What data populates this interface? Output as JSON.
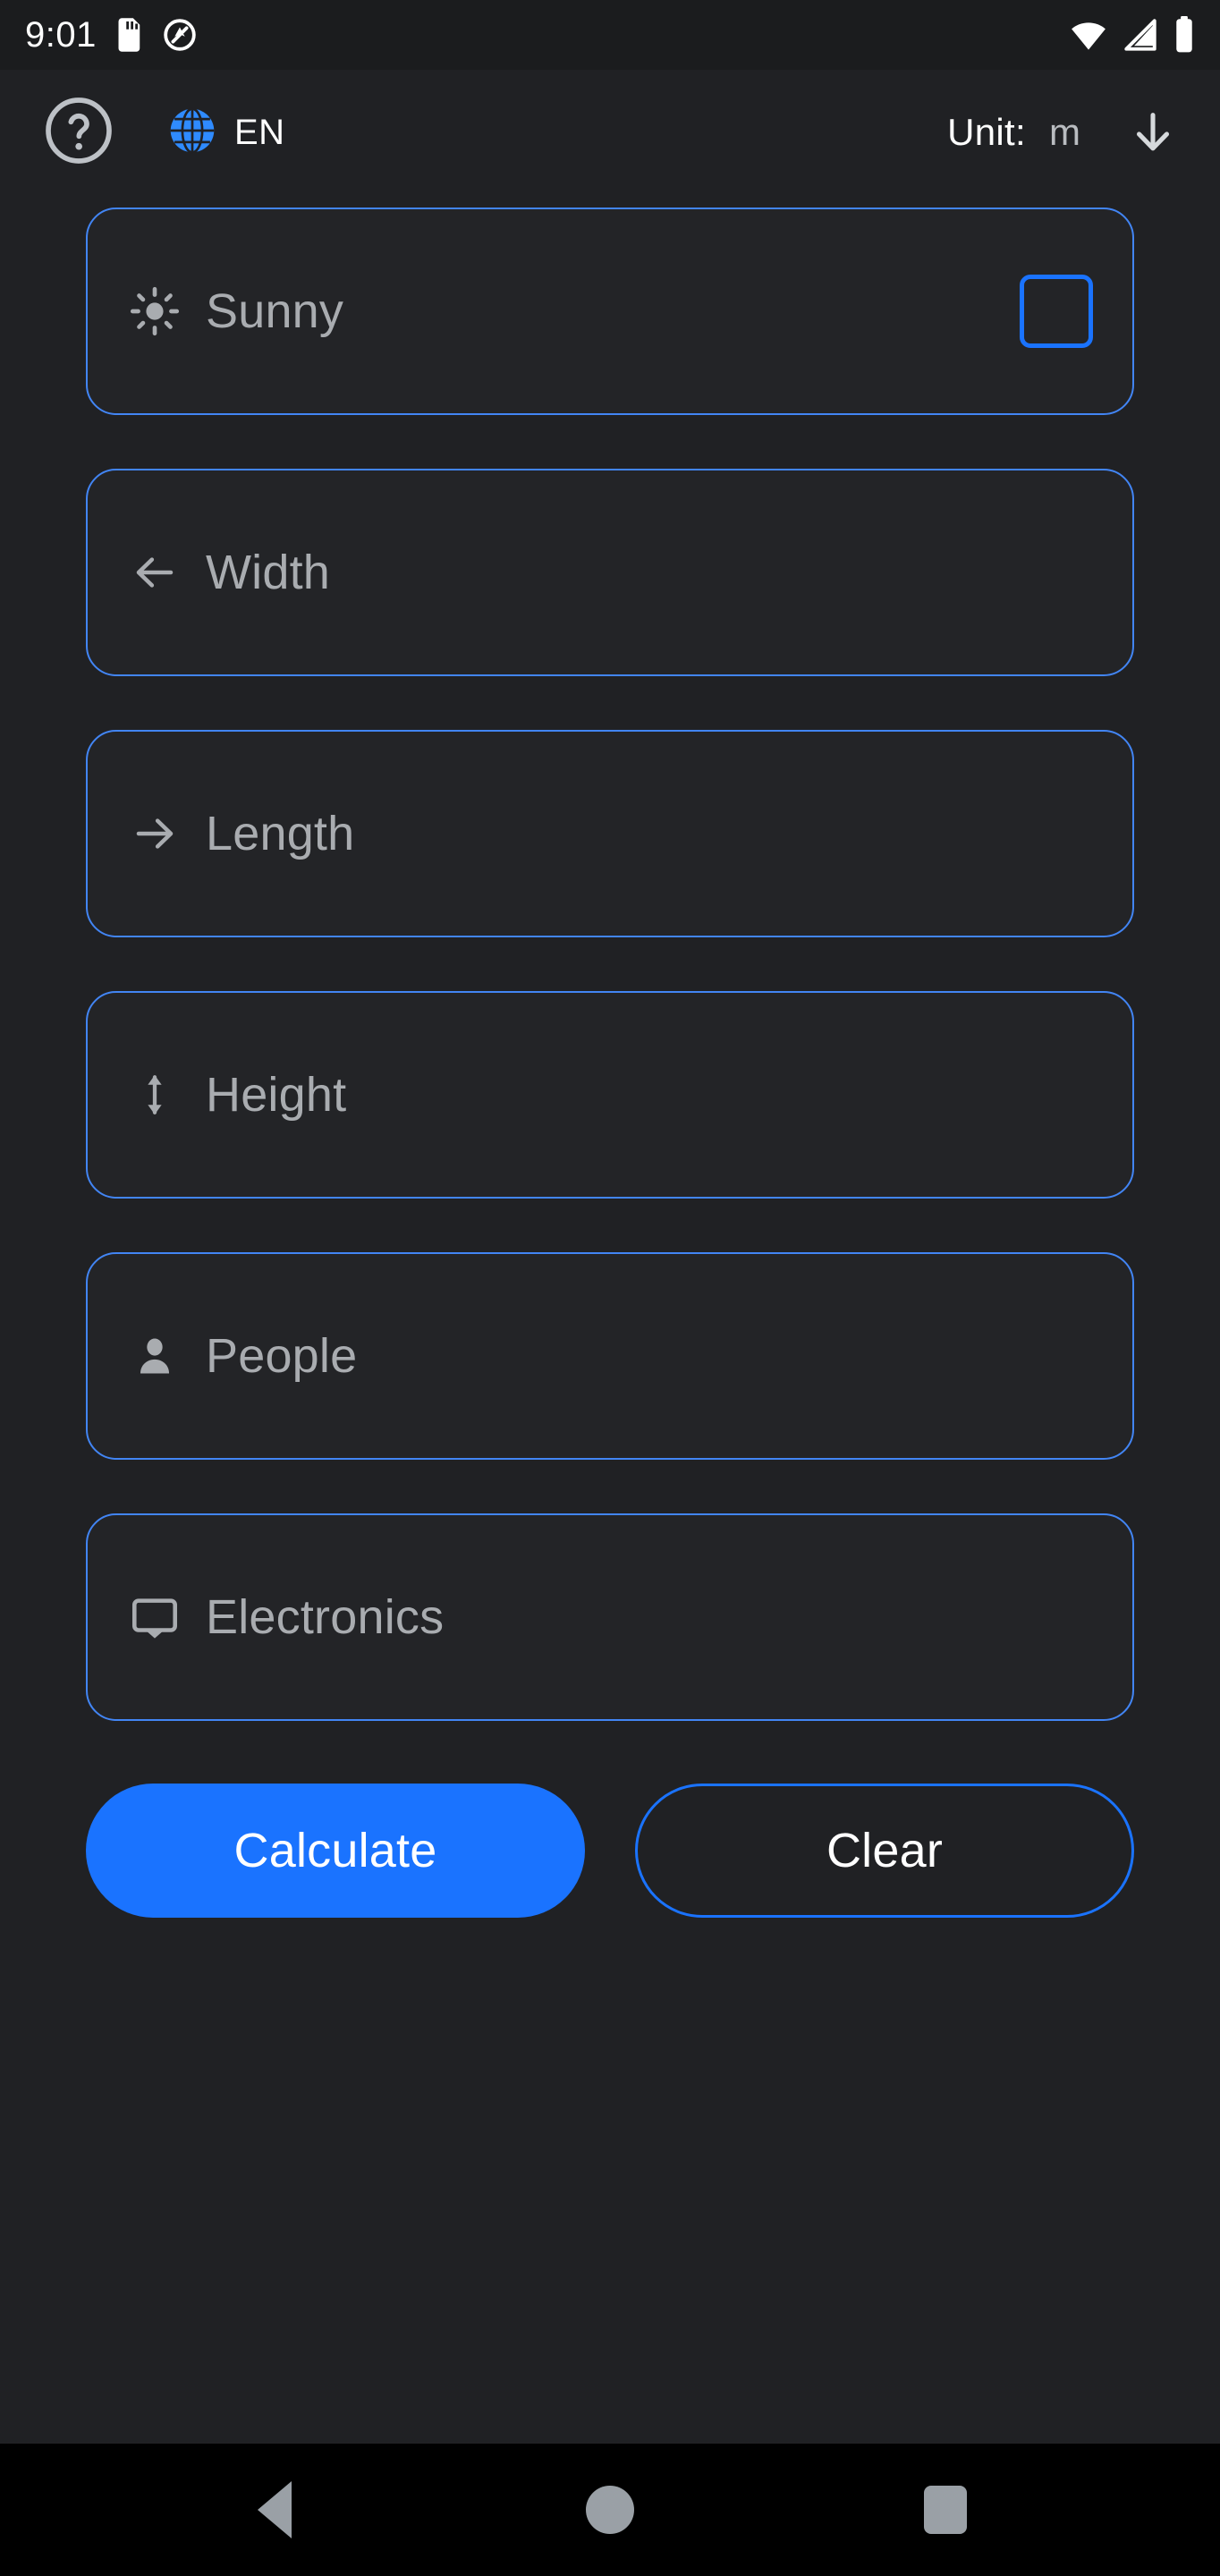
{
  "status_bar": {
    "time": "9:01",
    "left_icons": [
      "sd-card-icon",
      "do-not-disturb-icon"
    ],
    "right_icons": [
      "wifi-icon",
      "cellular-signal-icon",
      "battery-icon"
    ],
    "background": "#1b1c1e"
  },
  "header": {
    "help_icon": "help-circle-icon",
    "language_icon": "globe-icon",
    "language_code": "EN",
    "unit_label": "Unit:",
    "unit_value": "m",
    "unit_arrow_icon": "arrow-down-icon",
    "globe_color": "#2f8bff"
  },
  "form": {
    "fields": [
      {
        "id": "sunny",
        "label": "Sunny",
        "icon": "sun-icon",
        "type": "checkbox",
        "checked": false,
        "value": ""
      },
      {
        "id": "width",
        "label": "Width",
        "icon": "arrow-left-icon",
        "type": "text",
        "value": ""
      },
      {
        "id": "length",
        "label": "Length",
        "icon": "arrow-right-icon",
        "type": "text",
        "value": ""
      },
      {
        "id": "height",
        "label": "Height",
        "icon": "arrow-up-down-icon",
        "type": "text",
        "value": ""
      },
      {
        "id": "people",
        "label": "People",
        "icon": "person-icon",
        "type": "text",
        "value": ""
      },
      {
        "id": "electronics",
        "label": "Electronics",
        "icon": "tv-cast-icon",
        "type": "text",
        "value": ""
      }
    ]
  },
  "actions": {
    "calculate_label": "Calculate",
    "clear_label": "Clear"
  },
  "nav_bar": {
    "back_icon": "triangle-back-icon",
    "home_icon": "circle-home-icon",
    "recents_icon": "square-recents-icon"
  },
  "colors": {
    "accent_blue": "#1a73ff",
    "border_blue": "#4285f4",
    "background": "#202124",
    "field_background": "#232427",
    "placeholder_text": "#a9acb0",
    "nav_background": "#000000"
  }
}
